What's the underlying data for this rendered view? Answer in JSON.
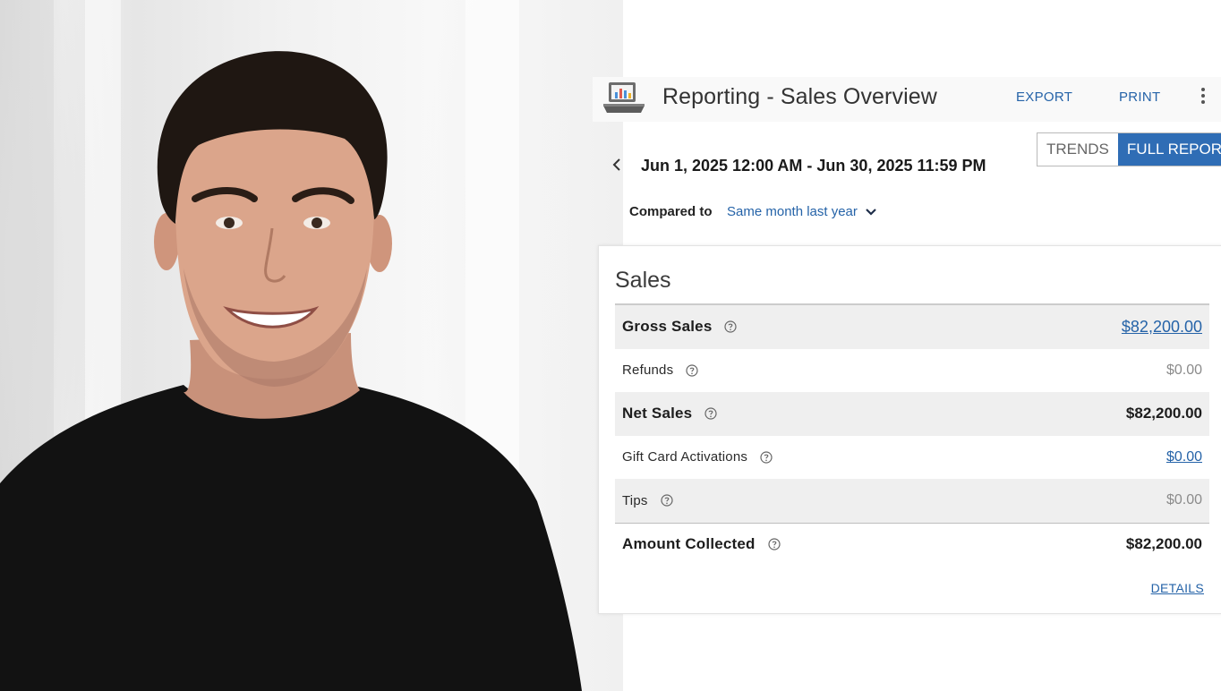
{
  "header": {
    "title": "Reporting - Sales Overview",
    "export_label": "EXPORT",
    "print_label": "PRINT"
  },
  "view_toggle": {
    "trends_label": "TRENDS",
    "full_report_label": "FULL REPORT",
    "selected": "FULL REPORT"
  },
  "date_range": "Jun 1, 2025 12:00 AM - Jun 30, 2025 11:59 PM",
  "comparison": {
    "label": "Compared to",
    "selected": "Same month last year"
  },
  "sales_card": {
    "title": "Sales",
    "rows": [
      {
        "label": "Gross Sales",
        "value": "$82,200.00"
      },
      {
        "label": "Refunds",
        "value": "$0.00"
      },
      {
        "label": "Net Sales",
        "value": "$82,200.00"
      },
      {
        "label": "Gift Card Activations",
        "value": "$0.00"
      },
      {
        "label": "Tips",
        "value": "$0.00"
      },
      {
        "label": "Amount Collected",
        "value": "$82,200.00"
      }
    ],
    "details_label": "DETAILS"
  },
  "icons": {
    "app": "reporting-register-icon",
    "help": "question-circle-icon",
    "back": "chevron-left-icon",
    "dropdown": "chevron-down-icon",
    "menu": "vertical-dots-icon"
  },
  "colors": {
    "accent": "#2f6db5",
    "link": "#2563a8",
    "row_shade": "#efefef"
  }
}
